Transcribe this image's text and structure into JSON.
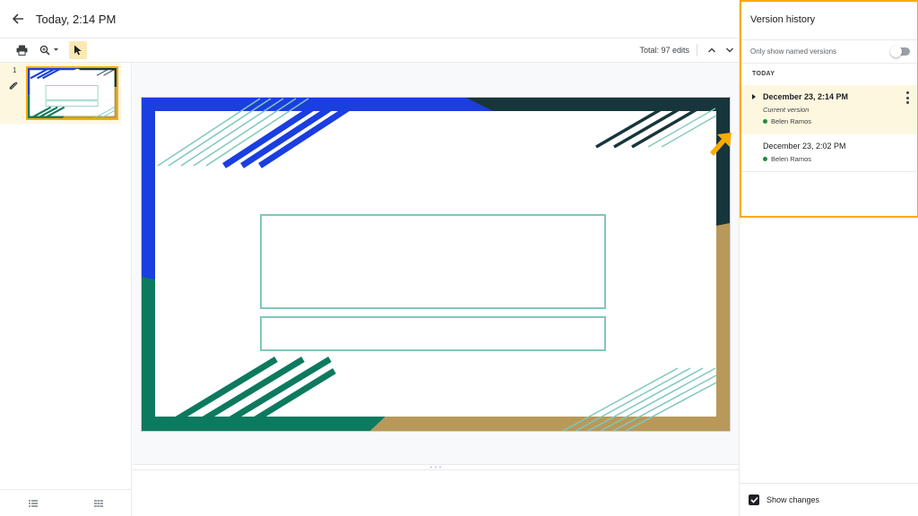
{
  "header": {
    "title": "Today, 2:14 PM"
  },
  "toolbar": {
    "total_edits": "Total: 97 edits"
  },
  "filmstrip": {
    "slides": [
      {
        "number": "1"
      }
    ]
  },
  "version_panel": {
    "title": "Version history",
    "named_toggle_label": "Only show named versions",
    "named_toggle_on": false,
    "section_label": "TODAY",
    "versions": [
      {
        "date": "December 23, 2:14 PM",
        "subtitle": "Current version",
        "user": "Belen Ramos"
      },
      {
        "date": "December 23, 2:02 PM",
        "user": "Belen Ramos"
      }
    ],
    "show_changes_label": "Show changes",
    "show_changes_checked": true
  },
  "colors": {
    "accent": "#f9ab00",
    "blue": "#1a3ee0",
    "dark_teal": "#17363b",
    "green": "#0d7a5f",
    "gold": "#b8995a",
    "outline": "#7fc8bb",
    "user_dot": "#1e8e3e"
  },
  "icons": [
    "back-arrow-icon",
    "print-icon",
    "zoom-icon",
    "pointer-icon",
    "chevron-up-icon",
    "chevron-down-icon",
    "comment-icon",
    "list-view-icon",
    "grid-view-icon",
    "caret-right-icon",
    "more-vert-icon",
    "checkmark-icon"
  ]
}
